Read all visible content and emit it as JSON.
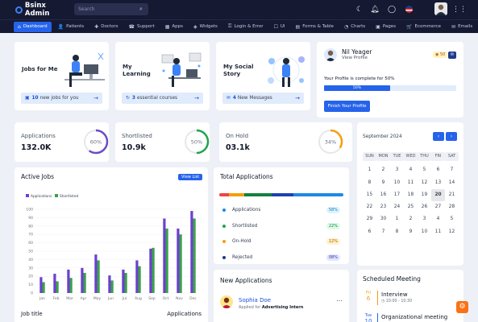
{
  "header": {
    "brand": "Bsinx Admin",
    "search_placeholder": "Search",
    "icons": [
      "moon-icon",
      "bell-icon",
      "chat-icon",
      "flag-icon",
      "avatar",
      "grid-icon"
    ]
  },
  "nav": [
    {
      "label": "Dashboard",
      "icon": "⌂",
      "active": true
    },
    {
      "label": "Patients",
      "icon": "👤"
    },
    {
      "label": "Doctors",
      "icon": "✚"
    },
    {
      "label": "Support",
      "icon": "☎"
    },
    {
      "label": "Apps",
      "icon": "▦"
    },
    {
      "label": "Widgets",
      "icon": "◈"
    },
    {
      "label": "Login & Error",
      "icon": "⚿"
    },
    {
      "label": "UI",
      "icon": "☐"
    },
    {
      "label": "Forms & Table",
      "icon": "▤"
    },
    {
      "label": "Charts",
      "icon": "◔"
    },
    {
      "label": "Pages",
      "icon": "▣"
    },
    {
      "label": "Ecommerce",
      "icon": "🛒"
    },
    {
      "label": "Emails",
      "icon": "✉"
    }
  ],
  "promos": [
    {
      "title": "Jobs for Me",
      "count": "10",
      "text": "new jobs for you",
      "icon": "briefcase-icon"
    },
    {
      "title": "My Learning",
      "count": "3",
      "text": "essential courses",
      "icon": "refresh-icon"
    },
    {
      "title": "My Social Story",
      "count": "4",
      "text": "New Messages",
      "icon": "message-icon"
    }
  ],
  "profile": {
    "name": "Nil Yeager",
    "link": "View Profile",
    "badge": "50",
    "complete_text": "Your Profile is complete for 50%",
    "percent": 0.5,
    "percent_label": "50%",
    "button": "Finish Your Profile"
  },
  "stats": [
    {
      "label": "Applications",
      "value": "132.0K",
      "percent": 60,
      "pct_label": "60%",
      "color": "#6b4bc7"
    },
    {
      "label": "Shortlisted",
      "value": "10.9k",
      "percent": 50,
      "pct_label": "50%",
      "color": "#22a34a"
    },
    {
      "label": "On Hold",
      "value": "03.1k",
      "percent": 34,
      "pct_label": "34%",
      "color": "#f59e0b"
    }
  ],
  "calendar": {
    "month": "September 2024",
    "days_of_week": [
      "SUN",
      "MON",
      "TUE",
      "WED",
      "THU",
      "FRI",
      "SAT"
    ],
    "weeks": [
      [
        "1",
        "2",
        "3",
        "4",
        "5",
        "6",
        "7"
      ],
      [
        "8",
        "9",
        "10",
        "11",
        "12",
        "13",
        "14"
      ],
      [
        "15",
        "16",
        "17",
        "18",
        "19",
        "20",
        "21"
      ],
      [
        "22",
        "23",
        "24",
        "25",
        "26",
        "27",
        "28"
      ],
      [
        "29",
        "30",
        "1",
        "2",
        "3",
        "4",
        "5"
      ],
      [
        "6",
        "7",
        "8",
        "9",
        "10",
        "11",
        "12"
      ]
    ],
    "today": "20"
  },
  "active_jobs": {
    "title": "Active Jobs",
    "view_all": "View List",
    "chart_data": {
      "type": "bar",
      "categories": [
        "Jan",
        "Feb",
        "Mar",
        "Apr",
        "May",
        "Jun",
        "Jul",
        "Aug",
        "Sep",
        "Oct",
        "Nov",
        "Dec"
      ],
      "series": [
        {
          "name": "Applications",
          "values": [
            19,
            23,
            28,
            30,
            46,
            21,
            28,
            39,
            53,
            89,
            77,
            98
          ],
          "color": "#6d3fd0"
        },
        {
          "name": "Shortlisted",
          "values": [
            13,
            14,
            18,
            24,
            39,
            15,
            24,
            32,
            54,
            77,
            70,
            89
          ],
          "color": "#3aa14a"
        }
      ],
      "ylim": [
        0,
        100
      ],
      "yticks": [
        "0",
        "10",
        "20",
        "30",
        "40",
        "50",
        "60",
        "70",
        "80",
        "90",
        "100"
      ]
    },
    "table_headers": [
      "Job title",
      "Applications"
    ]
  },
  "total_applications": {
    "title": "Total Applications",
    "segments": [
      {
        "color": "#ef4444",
        "fraction": 0.08
      },
      {
        "color": "#f59e0b",
        "fraction": 0.12
      },
      {
        "color": "#15803d",
        "fraction": 0.22
      },
      {
        "color": "#1e40af",
        "fraction": 0.18
      },
      {
        "color": "#1e88e5",
        "fraction": 0.4
      }
    ],
    "rows": [
      {
        "label": "Applications",
        "pct": "58%",
        "color": "#1e88e5",
        "badge_bg": "#e0f2fe",
        "badge_fg": "#0284c7"
      },
      {
        "label": "Shortlisted",
        "pct": "22%",
        "color": "#22a34a",
        "badge_bg": "#dcfce7",
        "badge_fg": "#15803d"
      },
      {
        "label": "On-Hold",
        "pct": "12%",
        "color": "#f59e0b",
        "badge_bg": "#fef3c7",
        "badge_fg": "#b45309"
      },
      {
        "label": "Rejected",
        "pct": "08%",
        "color": "#1e3a8a",
        "badge_bg": "#e0e7ff",
        "badge_fg": "#3730a3"
      }
    ]
  },
  "new_applications": {
    "title": "New Applications",
    "items": [
      {
        "name": "Sophia Doe",
        "role_prefix": "Applied for",
        "role": "Advertising Intern",
        "more": "⋯"
      }
    ]
  },
  "meetings": {
    "title": "Scheduled Meeting",
    "items": [
      {
        "day": "Fri",
        "date": "6",
        "title": "Interview",
        "time": "10:00 - 10:30",
        "color": "#f59e0b"
      },
      {
        "day": "Tue",
        "date": "10",
        "title": "Organizational meeting",
        "time": "",
        "color": "#2563eb"
      }
    ]
  },
  "floating_button_icon": "gear-icon"
}
